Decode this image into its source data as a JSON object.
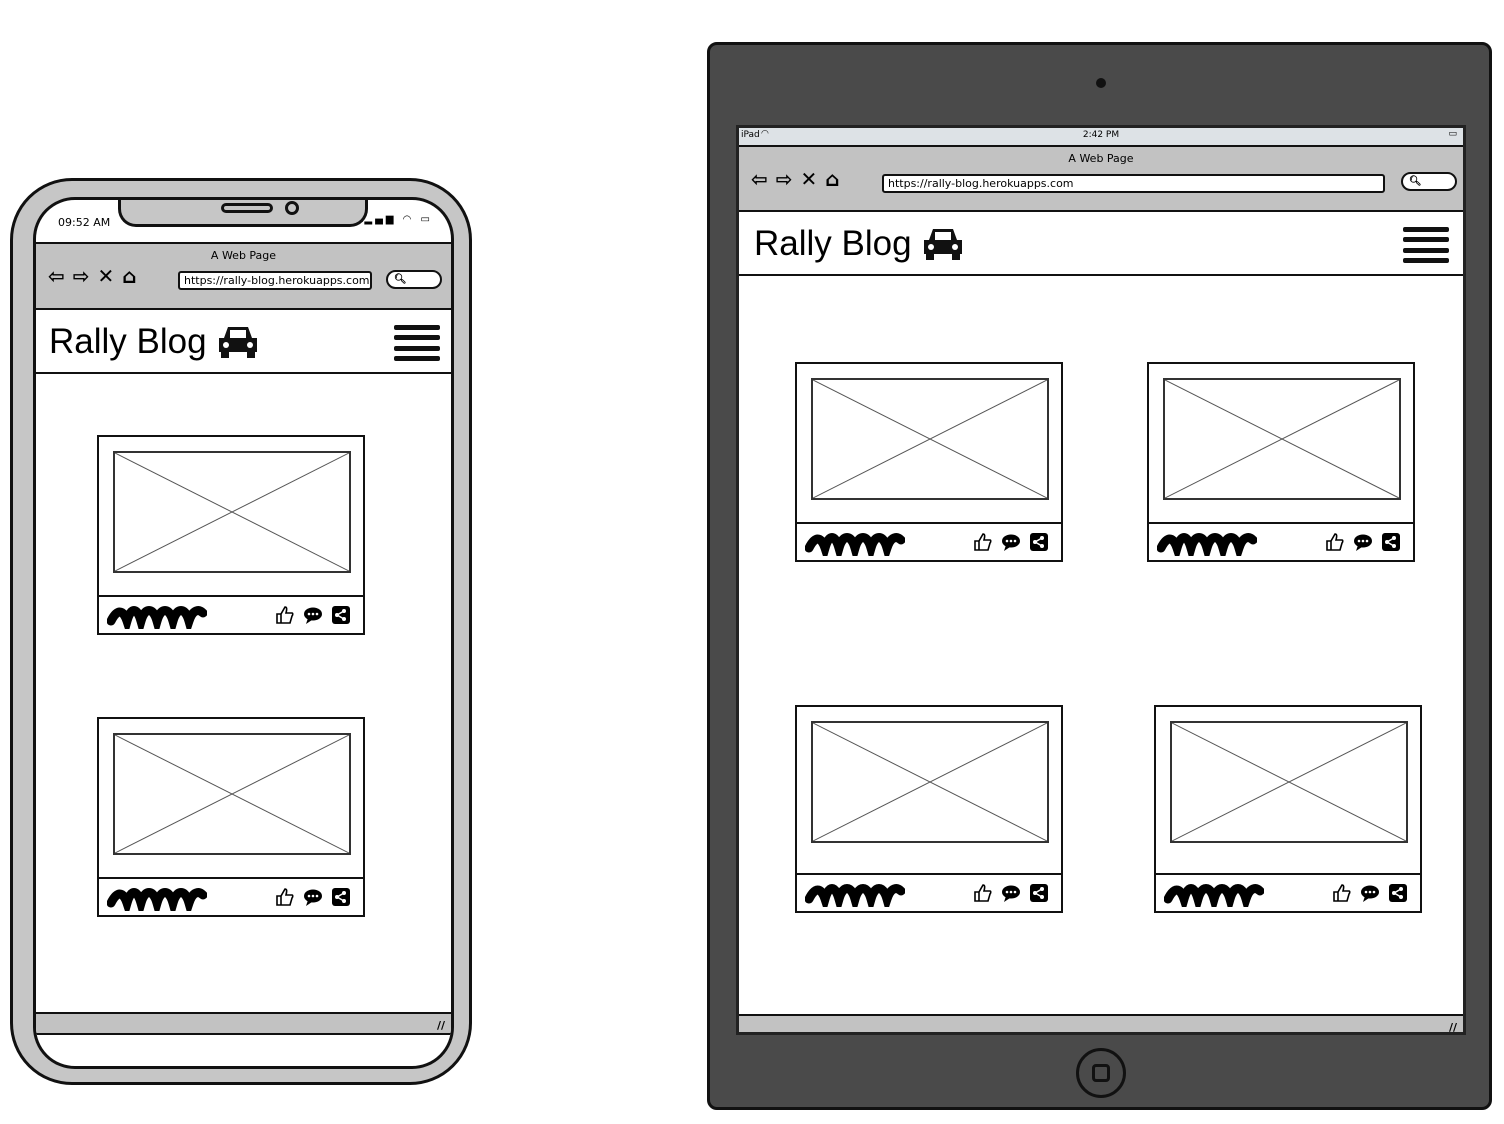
{
  "phone": {
    "status_time": "09:52 AM",
    "page_title": "A Web Page",
    "url": "https://rally-blog.herokuapps.com",
    "logo_text": "Rally Blog",
    "cards": 2
  },
  "tablet": {
    "status_device": "iPad",
    "status_time": "2:42 PM",
    "page_title": "A Web Page",
    "url": "https://rally-blog.herokuapps.com",
    "logo_text": "Rally Blog",
    "cards": 4
  },
  "icons": [
    "back-arrow-icon",
    "forward-arrow-icon",
    "close-icon",
    "home-icon",
    "search-icon",
    "car-icon",
    "hamburger-menu-icon",
    "thumbs-up-icon",
    "comment-icon",
    "share-icon",
    "resize-grip-icon"
  ],
  "colors": {
    "frame_light": "#c6c6c6",
    "frame_dark": "#4a4a4a",
    "browser_bar": "#c2c2c2",
    "status_bar_tablet": "#dde2e6"
  }
}
